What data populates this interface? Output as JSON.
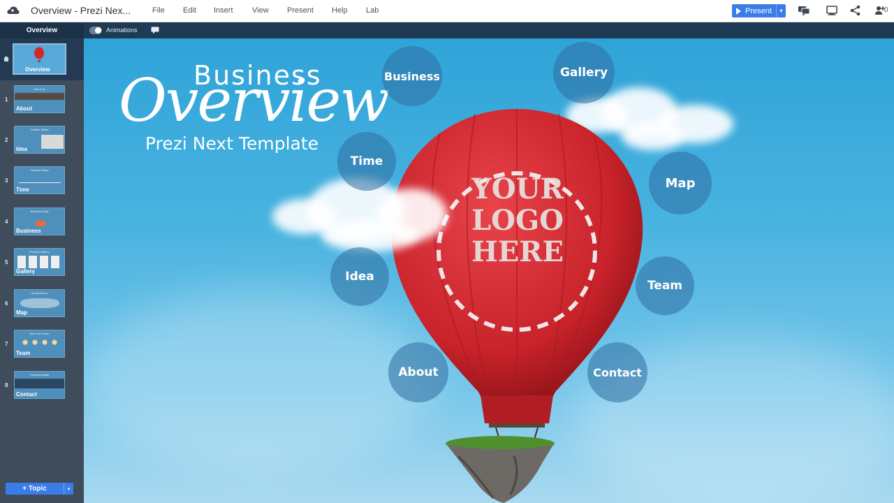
{
  "app": {
    "doc_title": "Overview - Prezi Nex..."
  },
  "menu": [
    "File",
    "Edit",
    "Insert",
    "View",
    "Present",
    "Help",
    "Lab"
  ],
  "toolbar": {
    "present_label": "Present",
    "present_caret": "▾",
    "collaborators_count": "0"
  },
  "subbar": {
    "overview_label": "Overview",
    "animations_label": "Animations",
    "animations_on": true
  },
  "sidebar": {
    "overview_caption": "Overview",
    "slides": [
      {
        "num": "1",
        "caption": "About",
        "heading": "About Us"
      },
      {
        "num": "2",
        "caption": "Idea",
        "heading": "Content Slides"
      },
      {
        "num": "3",
        "caption": "Time",
        "heading": "Timeline Steps"
      },
      {
        "num": "4",
        "caption": "Business",
        "heading": "Business Data"
      },
      {
        "num": "5",
        "caption": "Gallery",
        "heading": "Portfolio Gallery"
      },
      {
        "num": "6",
        "caption": "Map",
        "heading": "Global Reach"
      },
      {
        "num": "7",
        "caption": "Team",
        "heading": "Meet The Team"
      },
      {
        "num": "8",
        "caption": "Contact",
        "heading": "Contact Details"
      }
    ],
    "add_topic_label": "+ Topic",
    "add_topic_caret": "▾"
  },
  "canvas": {
    "title_small": "Business",
    "title_large": "Overview",
    "subtitle": "Prezi Next Template",
    "logo_lines": [
      "YOUR",
      "LOGO",
      "HERE"
    ],
    "topics": [
      "Business",
      "Gallery",
      "Time",
      "Map",
      "Idea",
      "Team",
      "About",
      "Contact"
    ]
  },
  "colors": {
    "accent": "#3b7de8",
    "balloon_red": "#d4262c",
    "sky": "#49b3e0",
    "sidebar": "#3e4c5b"
  }
}
